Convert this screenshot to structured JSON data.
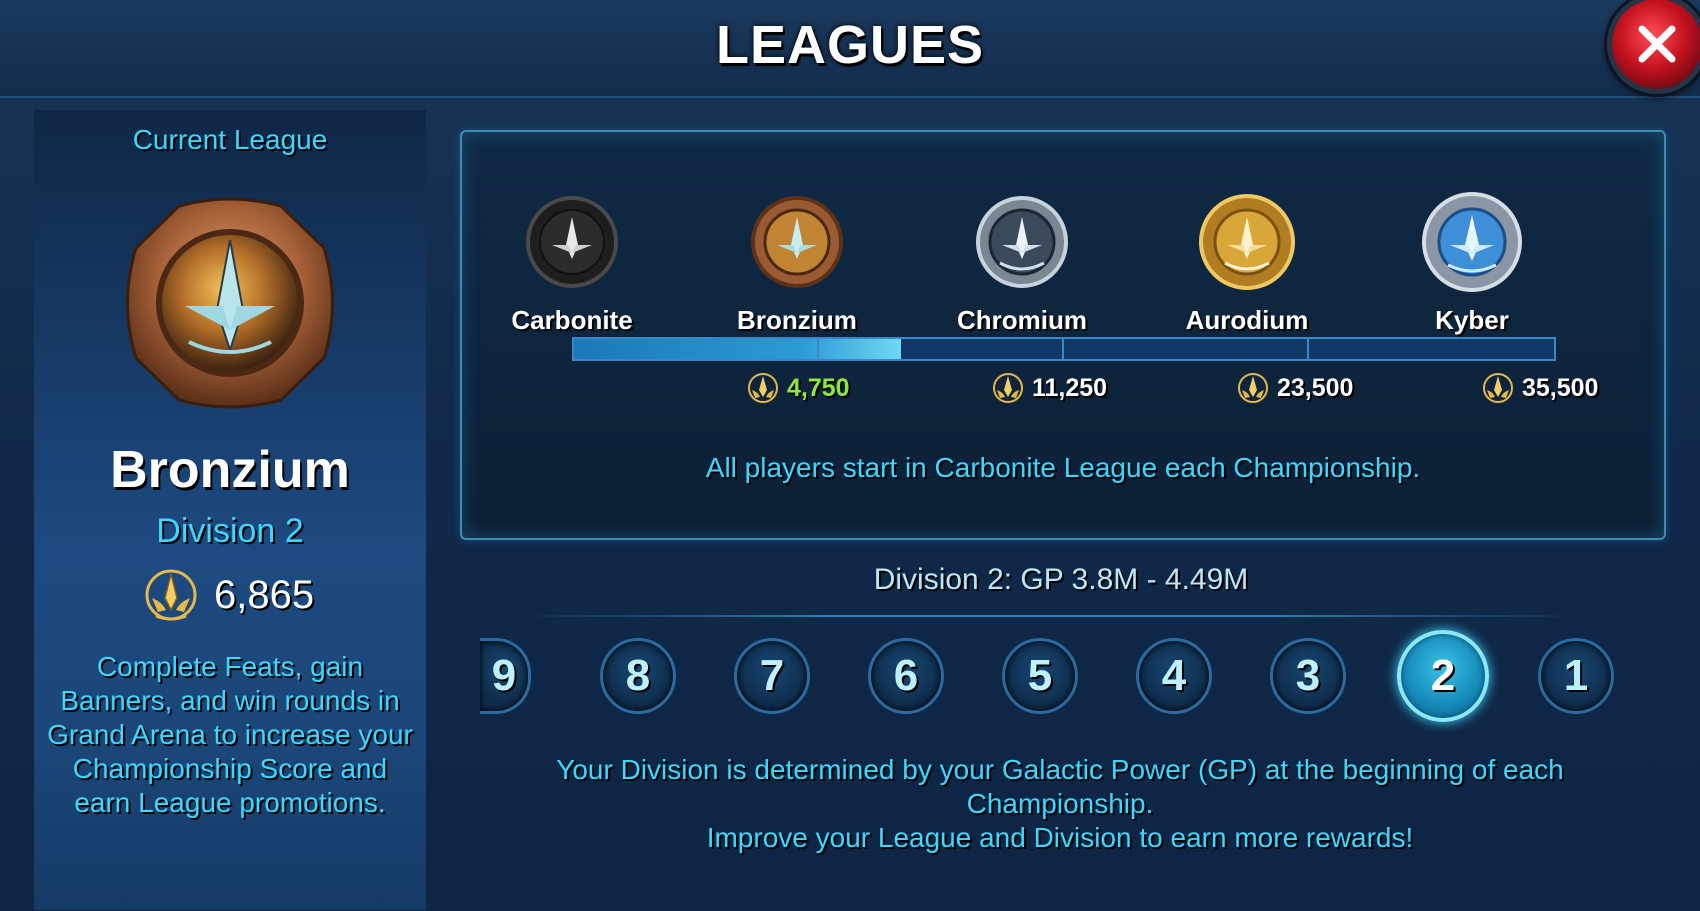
{
  "header": {
    "title": "LEAGUES"
  },
  "current": {
    "label": "Current League",
    "league": "Bronzium",
    "division": "Division 2",
    "score": "6,865",
    "description_lines": [
      "Complete Feats, gain",
      "Banners, and win rounds in",
      "Grand Arena to increase your",
      "Championship Score and",
      "earn League promotions."
    ]
  },
  "leagues": [
    {
      "name": "Carbonite",
      "threshold": "",
      "color": "#3a3a3a"
    },
    {
      "name": "Bronzium",
      "threshold": "4,750",
      "color": "#a8622f"
    },
    {
      "name": "Chromium",
      "threshold": "11,250",
      "color": "#aab4c0"
    },
    {
      "name": "Aurodium",
      "threshold": "23,500",
      "color": "#d9a63a"
    },
    {
      "name": "Kyber",
      "threshold": "35,500",
      "color": "#5aa7e8"
    }
  ],
  "progress": 0.334,
  "leagues_note": "All players start in Carbonite League each Championship.",
  "division_range": "Division 2: GP 3.8M - 4.49M",
  "divisions": [
    "9",
    "8",
    "7",
    "6",
    "5",
    "4",
    "3",
    "2",
    "1"
  ],
  "selected_division": "2",
  "bottom_note_lines": [
    "Your Division is determined by your Galactic Power (GP) at the beginning of each",
    "Championship.",
    "Improve your League and Division to earn more rewards!"
  ],
  "colors": {
    "accent": "#3fd6ff",
    "current_threshold": "#8ee83a",
    "threshold_default": "#ffffff"
  }
}
